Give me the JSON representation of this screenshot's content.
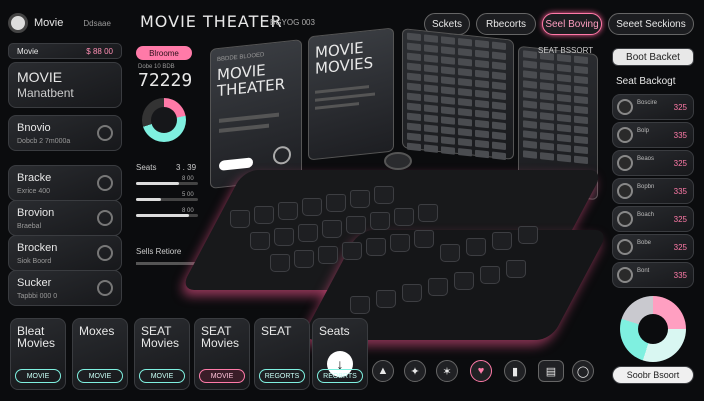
{
  "header": {
    "app_name": "Movie",
    "app_tag": "Ddsaae",
    "title": "MOVIE THEATER",
    "subtitle": "BGYOG 003",
    "nav": [
      "Sckets",
      "Rbecorts",
      "Seel Boving",
      "Seeet Seckions"
    ]
  },
  "left": {
    "search_label": "Movie",
    "search_value": "$ 88 00",
    "title": "MOVIE",
    "subtitle": "Manatbent",
    "cards": [
      {
        "title": "Bnovio",
        "sub": "Dobcb 2 7m000a"
      },
      {
        "title": "Bracke",
        "sub": "Exrice 400"
      },
      {
        "title": "Brovion",
        "sub": "Braebal"
      },
      {
        "title": "Brocken",
        "sub": "Siok Boord"
      },
      {
        "title": "Sucker",
        "sub": "Tapbbi 000 0"
      }
    ]
  },
  "stats": {
    "pill": "Blroome",
    "caption": "Dobe 10 BDB",
    "big_number": "72229",
    "seats_label": "Seats",
    "seats_value": "3 . 39",
    "rows": [
      "8 00",
      "5 00",
      "8 00"
    ],
    "sells_label": "Sells Retiore"
  },
  "posters": {
    "p1_title": "MOVIE THEATER",
    "p1_top": "BBDDE BLOOED",
    "p2_title": "MOVIE MOVIES"
  },
  "seatgrid": {
    "label": "SEAT BSSORT"
  },
  "right": {
    "top_button": "Boot Backet",
    "panel_title": "Seat Backogt",
    "rows": [
      {
        "t": "Boscire",
        "v": "325"
      },
      {
        "t": "Bolp",
        "v": "335"
      },
      {
        "t": "Beaos",
        "v": "325"
      },
      {
        "t": "Bopbn",
        "v": "335"
      },
      {
        "t": "Boach",
        "v": "325"
      },
      {
        "t": "Bobe",
        "v": "325"
      },
      {
        "t": "Bont",
        "v": "335"
      },
      {
        "t": "Bocd",
        "v": "335"
      }
    ],
    "bottom_button": "Soobr Bsoort"
  },
  "bottom": {
    "cards": [
      {
        "title": "Bleat Movies",
        "btn": "MOVIE",
        "active": false
      },
      {
        "title": "Moxes",
        "btn": "MOVIE",
        "active": false
      },
      {
        "title": "SEAT Movies",
        "btn": "MOVIE",
        "active": false
      },
      {
        "title": "SEAT Movies",
        "btn": "MOVIE",
        "active": true
      },
      {
        "title": "SEAT",
        "btn": "REGORTS",
        "active": false
      },
      {
        "title": "Seats",
        "btn": "REOBRTS",
        "active": false
      }
    ]
  },
  "colors": {
    "accent_teal": "#7ff0e0",
    "accent_pink": "#ff7aa8",
    "background": "#0b0c0e"
  },
  "icons": [
    "arrow-down-icon",
    "wedge-icon",
    "sparkle-icon",
    "heart-icon",
    "card-icon",
    "ticket-icon",
    "globe-icon"
  ]
}
